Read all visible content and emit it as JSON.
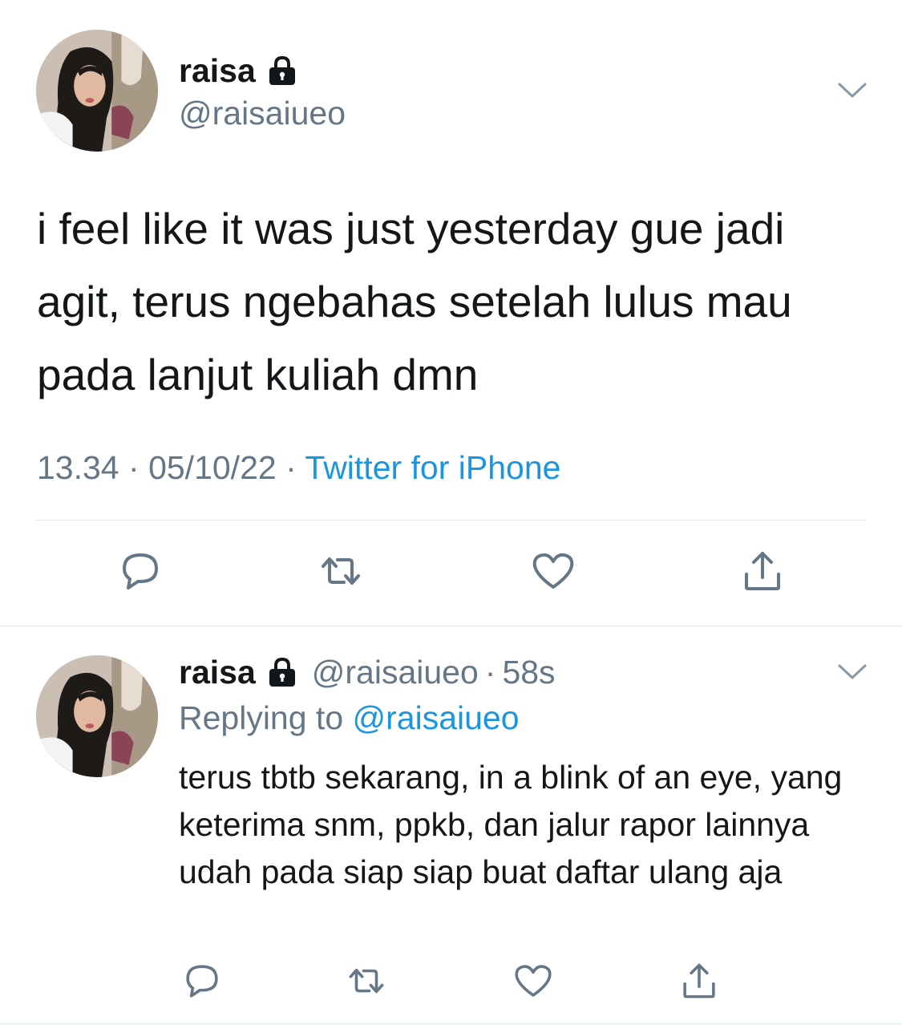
{
  "main_tweet": {
    "display_name": "raisa",
    "handle": "@raisaiueo",
    "text": "i feel like it was just yesterday gue jadi agit, terus ngebahas setelah lulus mau pada lanjut kuliah dmn",
    "time": "13.34",
    "separator": "·",
    "date": "05/10/22",
    "source": "Twitter for iPhone",
    "icons": {
      "lock": "lock-icon",
      "menu": "chevron-down-icon",
      "reply": "reply-icon",
      "retweet": "retweet-icon",
      "like": "heart-icon",
      "share": "share-icon"
    }
  },
  "reply_tweet": {
    "display_name": "raisa",
    "handle": "@raisaiueo",
    "separator": "·",
    "time": "58s",
    "replying_to_label": "Replying to",
    "replying_to_handle": "@raisaiueo",
    "text": "terus tbtb sekarang, in a blink of an eye, yang keterima snm, ppkb, dan jalur rapor lainnya udah pada siap siap buat daftar ulang aja"
  },
  "colors": {
    "text": "#14171a",
    "secondary": "#657786",
    "link": "#1b95e0",
    "divider": "#e1e8ed"
  }
}
